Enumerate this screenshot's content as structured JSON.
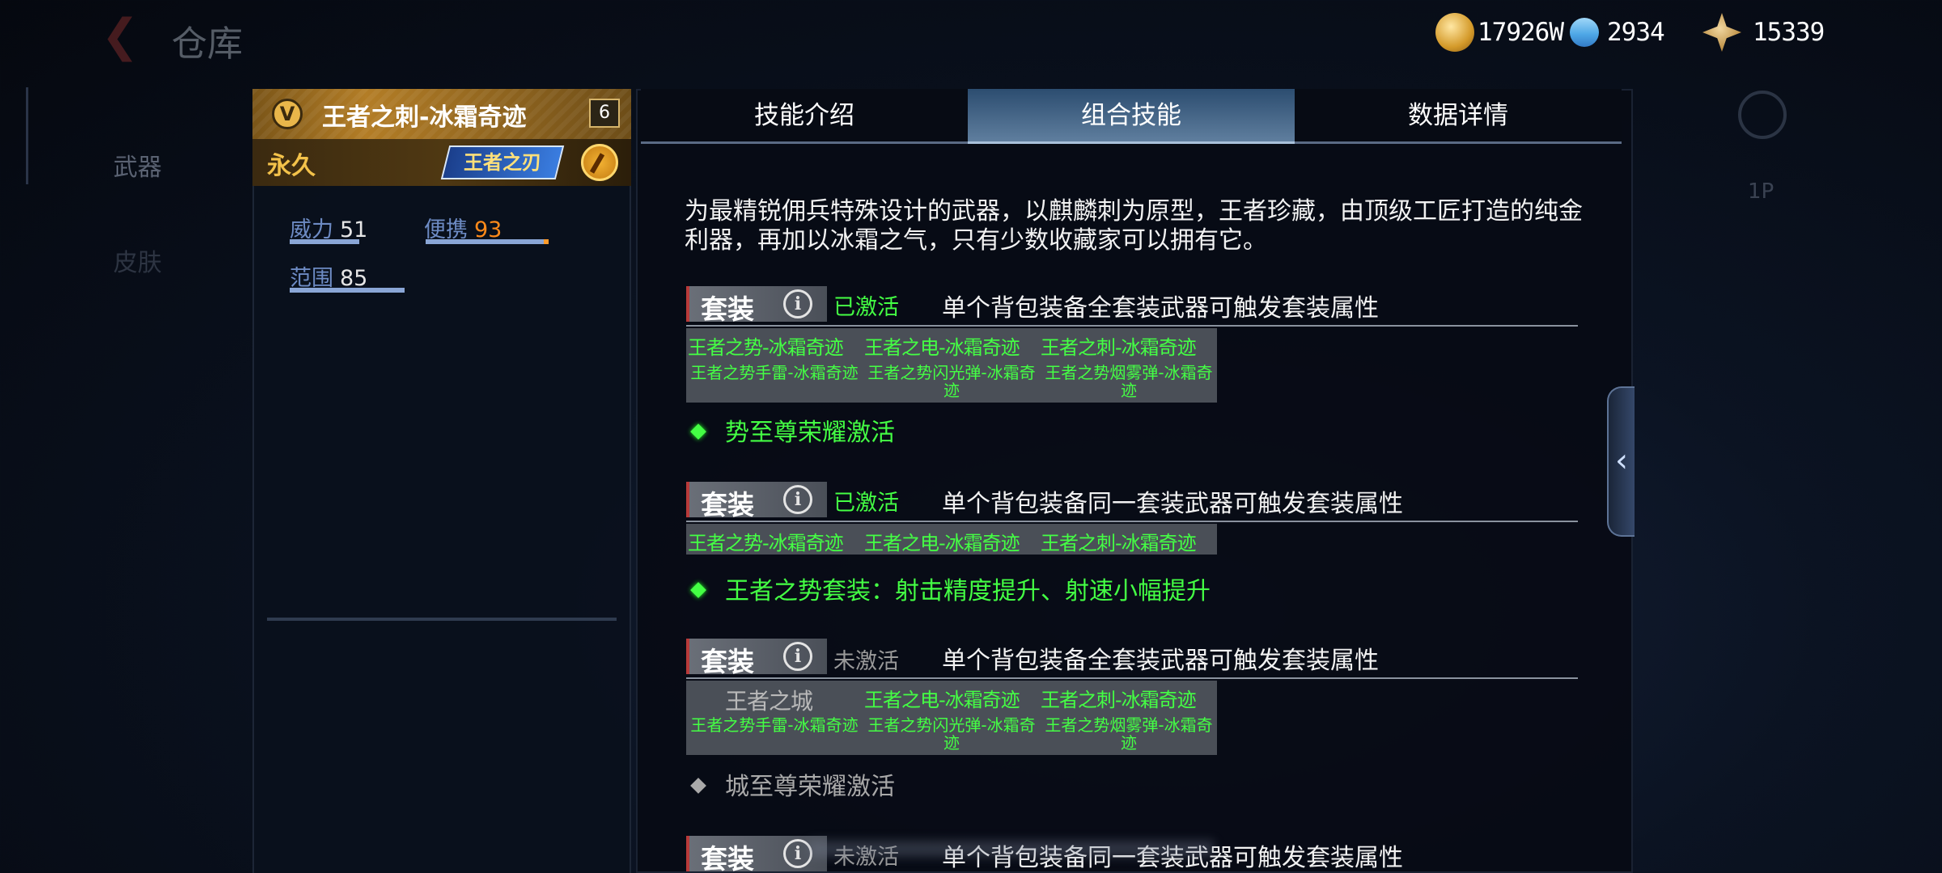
{
  "topbar": {
    "back_icon": "chevron-left-icon",
    "title": "仓库"
  },
  "sidebar_bg": {
    "weapon_tab": "武器",
    "skin_tab": "皮肤",
    "view_label": "1P"
  },
  "currency": {
    "gold": "17926W",
    "diamond": "2934",
    "medal": "15339"
  },
  "weapon": {
    "tier_icon_text": "V",
    "name": "王者之刺-冰霜奇迹",
    "level": "6",
    "duration": "永久",
    "badge": "王者之刃"
  },
  "stats": [
    {
      "label": "威力",
      "value": "51",
      "fill": 0.51
    },
    {
      "label": "便携",
      "value": "93",
      "fill": 0.93
    },
    {
      "label": "范围",
      "value": "85",
      "fill": 0.85
    }
  ],
  "tabs": [
    "技能介绍",
    "组合技能",
    "数据详情"
  ],
  "active_tab": 1,
  "description": "为最精锐佣兵特殊设计的武器，以麒麟刺为原型，王者珍藏，由顶级工匠打造的纯金利器，再加以冰霜之气，只有少数收藏家可以拥有它。",
  "sets": [
    {
      "label": "套装",
      "info_icon": "i",
      "status": "已激活",
      "desc": "单个背包装备全套装武器可触发套装属性",
      "top_items": [
        "王者之势-冰霜奇迹",
        "王者之电-冰霜奇迹",
        "王者之刺-冰霜奇迹"
      ],
      "bottom_items": [
        "王者之势手雷-冰霜奇迹",
        "王者之势闪光弹-冰霜奇迹",
        "王者之势烟雾弹-冰霜奇迹"
      ],
      "effect": "势至尊荣耀激活"
    },
    {
      "label": "套装",
      "info_icon": "i",
      "status": "已激活",
      "desc": "单个背包装备同一套装武器可触发套装属性",
      "top_items": [
        "王者之势-冰霜奇迹",
        "王者之电-冰霜奇迹",
        "王者之刺-冰霜奇迹"
      ],
      "effect": "王者之势套装：射击精度提升、射速小幅提升"
    },
    {
      "label": "套装",
      "info_icon": "i",
      "status": "未激活",
      "desc": "单个背包装备全套装武器可触发套装属性",
      "top_items": [
        "王者之城",
        "王者之电-冰霜奇迹",
        "王者之刺-冰霜奇迹"
      ],
      "bottom_items": [
        "王者之势手雷-冰霜奇迹",
        "王者之势闪光弹-冰霜奇迹",
        "王者之势烟雾弹-冰霜奇迹"
      ],
      "effect": "城至尊荣耀激活"
    },
    {
      "label": "套装",
      "info_icon": "i",
      "status": "未激活",
      "desc": "单个背包装备同一套装武器可触发套装属性"
    }
  ],
  "colors": {
    "active_green": "#44ff44",
    "inactive_grey": "#9a9a9a",
    "gold_header": "#b37d26",
    "tab_active": "#5f7e9e"
  }
}
